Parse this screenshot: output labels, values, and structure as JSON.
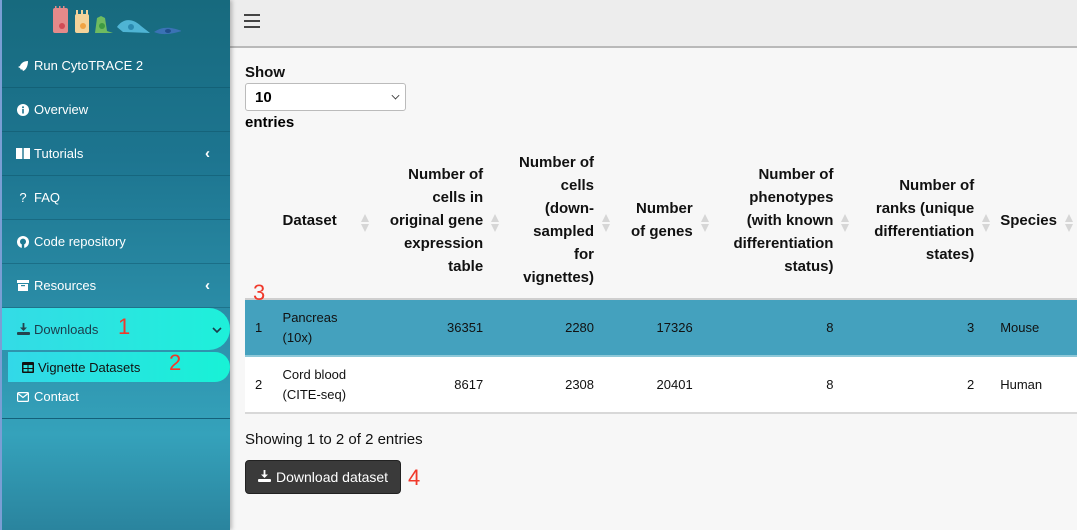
{
  "sidebar": {
    "logo_alt": "CytoTRACE 2 cell differentiation logo",
    "items": [
      {
        "label": "Run CytoTRACE 2",
        "icon": "rocket-icon"
      },
      {
        "label": "Overview",
        "icon": "info-circle-icon"
      },
      {
        "label": "Tutorials",
        "icon": "book-icon",
        "chevron": "‹"
      },
      {
        "label": "FAQ",
        "icon": "question-icon",
        "icon_glyph": "?"
      },
      {
        "label": "Code repository",
        "icon": "github-icon"
      },
      {
        "label": "Resources",
        "icon": "archive-icon",
        "chevron": "‹"
      },
      {
        "label": "Downloads",
        "icon": "download-icon",
        "chevron": "⌄",
        "active": true
      },
      {
        "label": "Vignette Datasets",
        "icon": "table-icon",
        "sub": true
      },
      {
        "label": "Contact",
        "icon": "envelope-icon"
      }
    ]
  },
  "annotations": {
    "a1": "1",
    "a2": "2",
    "a3": "3",
    "a4": "4"
  },
  "length_menu": {
    "show_label": "Show",
    "selected": "10",
    "entries_label": "entries"
  },
  "table": {
    "columns": [
      {
        "label": "",
        "align": "left"
      },
      {
        "label": "Dataset",
        "align": "left"
      },
      {
        "label": "Number of cells in original gene expression table",
        "align": "right"
      },
      {
        "label": "Number of cells (down-sampled for vignettes)",
        "align": "right"
      },
      {
        "label": "Number of genes",
        "align": "right"
      },
      {
        "label": "Number of phenotypes (with known differentiation status)",
        "align": "right"
      },
      {
        "label": "Number of ranks (unique differentiation states)",
        "align": "right"
      },
      {
        "label": "Species",
        "align": "left"
      }
    ],
    "rows": [
      {
        "index": "1",
        "dataset": "Pancreas (10x)",
        "cells_original": "36351",
        "cells_downsampled": "2280",
        "genes": "17326",
        "phenotypes": "8",
        "ranks": "3",
        "species": "Mouse",
        "selected": true
      },
      {
        "index": "2",
        "dataset": "Cord blood (CITE-seq)",
        "cells_original": "8617",
        "cells_downsampled": "2308",
        "genes": "20401",
        "phenotypes": "8",
        "ranks": "2",
        "species": "Human",
        "selected": false
      }
    ]
  },
  "info_text": "Showing 1 to 2 of 2 entries",
  "download_button": "Download dataset",
  "colors": {
    "selected_row": "#44a1be",
    "active_nav": "#1ef0da",
    "annotation": "#f0392b",
    "sidebar": "#1d7590"
  }
}
